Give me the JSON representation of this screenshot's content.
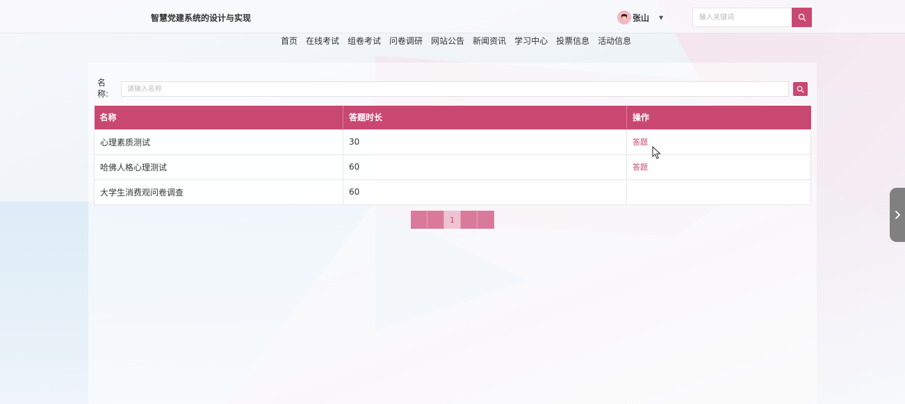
{
  "header": {
    "site_title": "智慧党建系统的设计与实现",
    "username": "张山",
    "search_placeholder": "输入关键词"
  },
  "nav": [
    "首页",
    "在线考试",
    "组卷考试",
    "问卷调研",
    "网站公告",
    "新闻资讯",
    "学习中心",
    "投票信息",
    "活动信息"
  ],
  "filter": {
    "label": "名称:",
    "placeholder": "请输入名称"
  },
  "table": {
    "headers": [
      "名称",
      "答题时长",
      "操作"
    ],
    "rows": [
      {
        "name": "心理素质测试",
        "duration": "30",
        "action": "答题"
      },
      {
        "name": "哈佛人格心理测试",
        "duration": "60",
        "action": "答题"
      },
      {
        "name": "大学生消费观问卷调查",
        "duration": "60",
        "action": ""
      }
    ]
  },
  "pager": {
    "current_page": "1"
  },
  "colors": {
    "accent": "#c94872",
    "pager_button": "#d97a9b",
    "pager_active": "#efc3d1"
  },
  "icons": {
    "search": "search-icon",
    "caret": "caret-down-icon",
    "side_tab": "chevron-right-icon"
  }
}
